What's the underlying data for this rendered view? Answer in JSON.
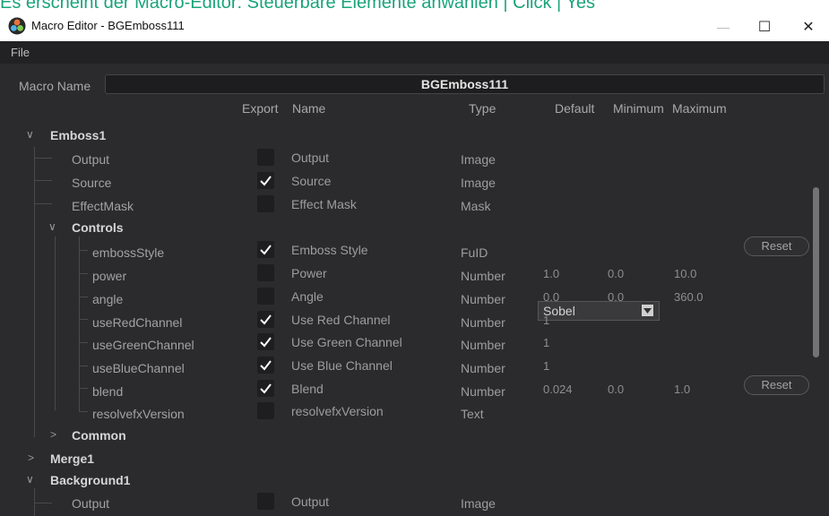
{
  "caption": "Es erscheint der Macro-Editor: Steuerbare Elemente anwählen | Click | Yes",
  "window": {
    "title": "Macro Editor - BGEmboss111",
    "minimize_glyph": "—",
    "maximize_glyph": "☐",
    "close_glyph": "✕"
  },
  "menu": {
    "file": "File"
  },
  "macro": {
    "label": "Macro Name",
    "value": "BGEmboss111"
  },
  "columns": {
    "export": "Export",
    "name": "Name",
    "type": "Type",
    "default": "Default",
    "minimum": "Minimum",
    "maximum": "Maximum"
  },
  "tree": {
    "emboss1": "Emboss1",
    "controls": "Controls",
    "common": "Common",
    "merge1": "Merge1",
    "background1": "Background1"
  },
  "rows": [
    {
      "id": "Output",
      "checked": false,
      "name": "Output",
      "type": "Image"
    },
    {
      "id": "Source",
      "checked": true,
      "name": "Source",
      "type": "Image"
    },
    {
      "id": "EffectMask",
      "checked": false,
      "name": "Effect Mask",
      "type": "Mask"
    },
    {
      "id": "embossStyle",
      "checked": true,
      "name": "Emboss Style",
      "type": "FuID",
      "default": "Sobel",
      "reset": "Reset"
    },
    {
      "id": "power",
      "checked": false,
      "name": "Power",
      "type": "Number",
      "default": "1.0",
      "minimum": "0.0",
      "maximum": "10.0"
    },
    {
      "id": "angle",
      "checked": false,
      "name": "Angle",
      "type": "Number",
      "default": "0.0",
      "minimum": "0.0",
      "maximum": "360.0"
    },
    {
      "id": "useRedChannel",
      "checked": true,
      "name": "Use Red Channel",
      "type": "Number",
      "default": "1"
    },
    {
      "id": "useGreenChannel",
      "checked": true,
      "name": "Use Green Channel",
      "type": "Number",
      "default": "1"
    },
    {
      "id": "useBlueChannel",
      "checked": true,
      "name": "Use Blue Channel",
      "type": "Number",
      "default": "1"
    },
    {
      "id": "blend",
      "checked": true,
      "name": "Blend",
      "type": "Number",
      "default": "0.024",
      "minimum": "0.0",
      "maximum": "1.0",
      "reset": "Reset"
    },
    {
      "id": "resolvefxVersion",
      "checked": false,
      "name": "resolvefxVersion",
      "type": "Text"
    }
  ],
  "background_rows": [
    {
      "id": "Output",
      "checked": false,
      "name": "Output",
      "type": "Image"
    }
  ],
  "colors": {
    "accent_caption": "#1aa37a",
    "panel_bg": "#2b2b2e",
    "menubar_bg": "#222225"
  },
  "icons": {
    "app": "davinci-resolve-icon",
    "expand": "chevron-down-icon",
    "collapse": "chevron-right-icon",
    "check": "check-icon",
    "dropdown": "dropdown-arrow-icon"
  }
}
